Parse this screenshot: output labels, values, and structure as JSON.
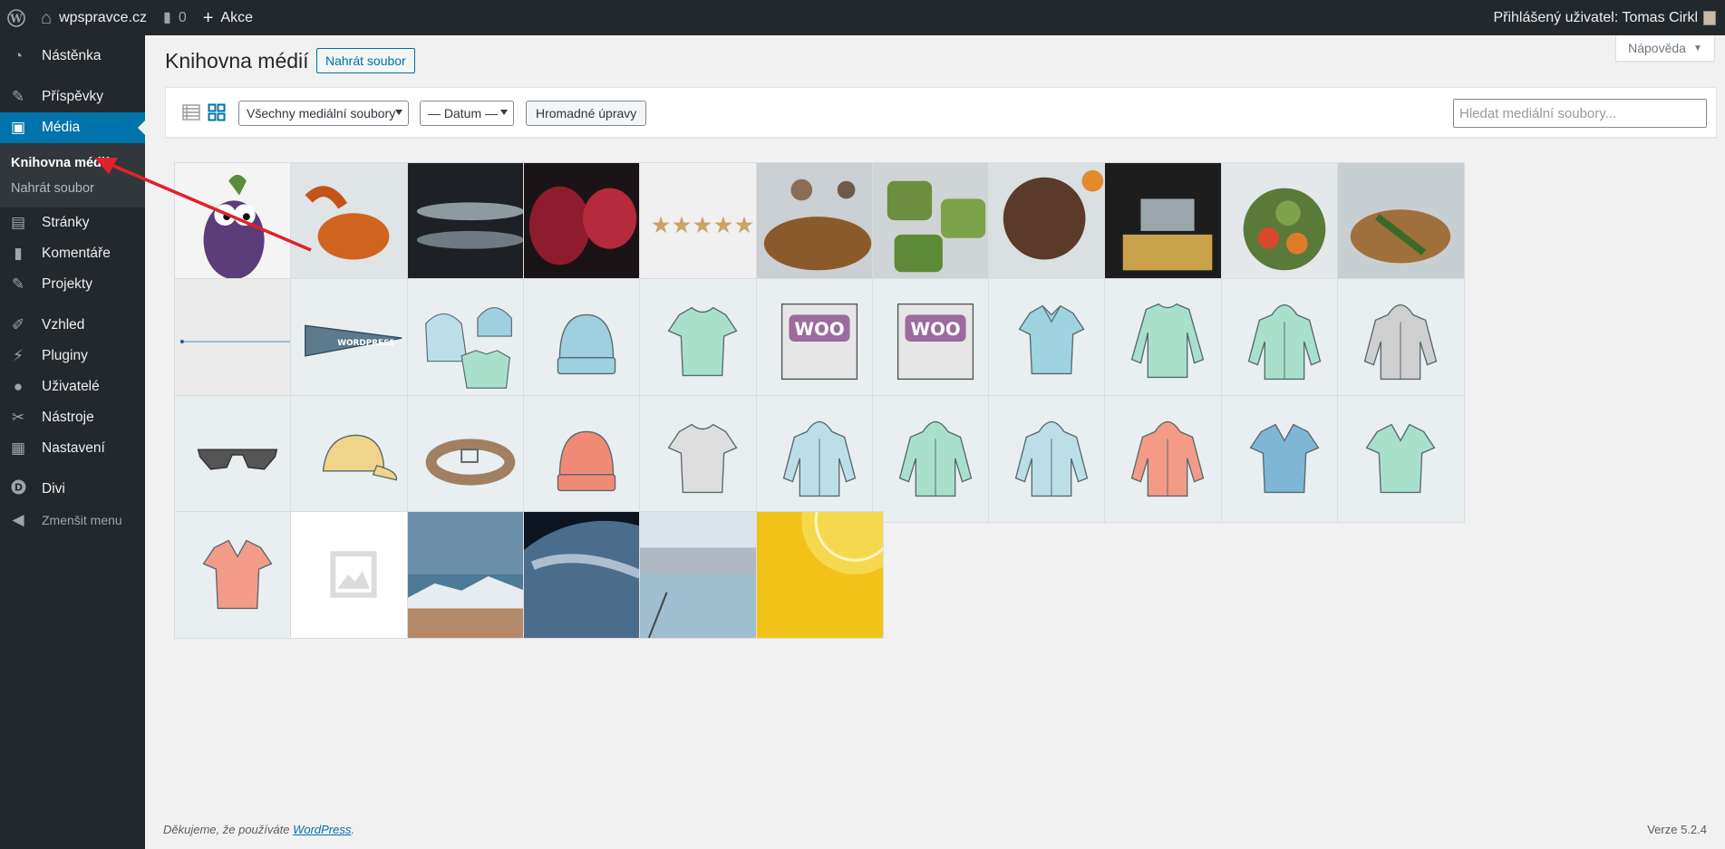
{
  "admin_bar": {
    "site_name": "wpspravce.cz",
    "comments_count": "0",
    "new_label": "Akce",
    "user_greeting": "Přihlášený uživatel: Tomas Cirkl"
  },
  "sidebar": {
    "items": [
      {
        "label": "Nástěnka",
        "icon": "dashboard-icon"
      },
      {
        "label": "Příspěvky",
        "icon": "pushpin-icon"
      },
      {
        "label": "Média",
        "icon": "media-icon",
        "current": true
      },
      {
        "label": "Stránky",
        "icon": "pages-icon"
      },
      {
        "label": "Komentáře",
        "icon": "comment-icon"
      },
      {
        "label": "Projekty",
        "icon": "pushpin-icon"
      },
      {
        "label": "Vzhled",
        "icon": "brush-icon"
      },
      {
        "label": "Pluginy",
        "icon": "plugin-icon"
      },
      {
        "label": "Uživatelé",
        "icon": "user-icon"
      },
      {
        "label": "Nástroje",
        "icon": "wrench-icon"
      },
      {
        "label": "Nastavení",
        "icon": "settings-icon"
      },
      {
        "label": "Divi",
        "icon": "divi-icon"
      },
      {
        "label": "Zmenšit menu",
        "icon": "collapse-icon"
      }
    ],
    "submenu": [
      {
        "label": "Knihovna médií",
        "current": true
      },
      {
        "label": "Nahrát soubor"
      }
    ]
  },
  "help_tab": "Nápověda",
  "page": {
    "title": "Knihovna médií",
    "add_new": "Nahrát soubor"
  },
  "toolbar": {
    "type_filter": "Všechny mediální soubory",
    "date_filter": "— Datum —",
    "bulk_button": "Hromadné úpravy",
    "search_placeholder": "Hledat mediální soubory..."
  },
  "media_tiles": [
    "eggplant-cartoon",
    "crab",
    "fish",
    "pomegranate",
    "five-stars",
    "cutting-board-mushrooms",
    "avocado-toast",
    "chocolate-cake",
    "cheese",
    "vegetable-basket",
    "herbs-board",
    "line-graphic",
    "pennant",
    "hoodie-beanie-tshirt",
    "beanie-blue",
    "tshirt-green",
    "woo-single",
    "woo-album",
    "polo-blue",
    "longsleeve-green",
    "hoodie-green-zip",
    "hoodie-gray",
    "sunglasses",
    "cap-yellow",
    "belt",
    "beanie-orange",
    "tshirt-gray",
    "hoodie-blue-logo",
    "hoodie-green-logo",
    "hoodie-blue",
    "hoodie-orange",
    "vneck-blue",
    "vneck-green",
    "vneck-orange",
    "placeholder-image",
    "mountain-landscape",
    "earth-from-space",
    "pool-city",
    "lemon-water"
  ],
  "footer": {
    "thanks_prefix": "Děkujeme, že používáte ",
    "thanks_link": "WordPress",
    "thanks_suffix": ".",
    "version": "Verze 5.2.4"
  },
  "colors": {
    "admin_dark": "#23282d",
    "accent": "#0073aa",
    "arrow": "#e0222a"
  }
}
